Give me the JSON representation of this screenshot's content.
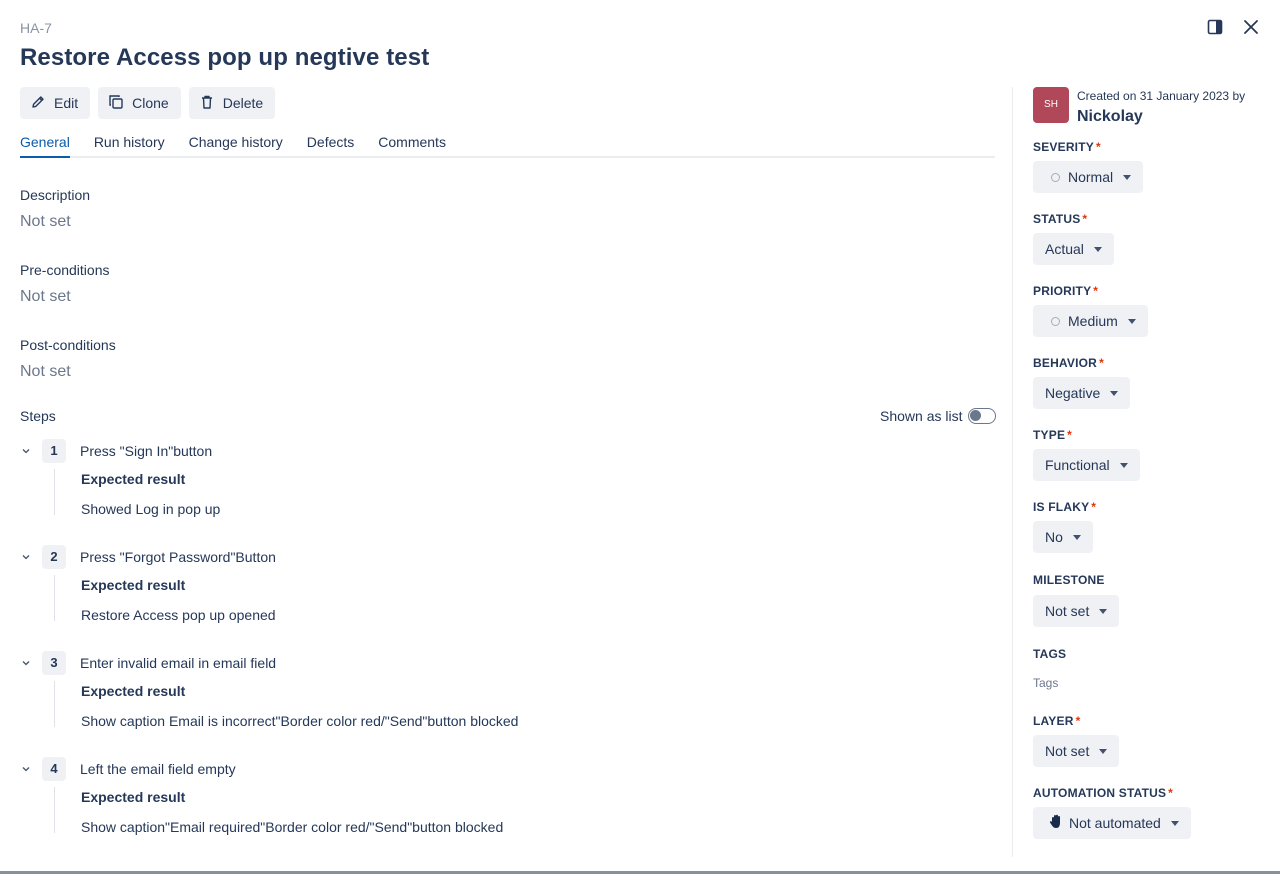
{
  "issue": {
    "key": "HA-7",
    "title": "Restore Access pop up negtive test"
  },
  "window_icons": [
    "panel-toggle-icon",
    "close-icon"
  ],
  "toolbar": {
    "edit_label": "Edit",
    "clone_label": "Clone",
    "delete_label": "Delete"
  },
  "tabs": [
    {
      "label": "General",
      "active": true
    },
    {
      "label": "Run history",
      "active": false
    },
    {
      "label": "Change history",
      "active": false
    },
    {
      "label": "Defects",
      "active": false
    },
    {
      "label": "Comments",
      "active": false
    }
  ],
  "general": {
    "description": {
      "label": "Description",
      "value": "Not set"
    },
    "preconditions": {
      "label": "Pre-conditions",
      "value": "Not set"
    },
    "postconditions": {
      "label": "Post-conditions",
      "value": "Not set"
    }
  },
  "steps": {
    "label": "Steps",
    "toggle_label": "Shown as list",
    "toggle_on": false,
    "expected_label": "Expected result",
    "items": [
      {
        "number": "1",
        "action": "Press \"Sign In\"button",
        "expected": "Showed Log in pop up"
      },
      {
        "number": "2",
        "action": "Press \"Forgot Password\"Button",
        "expected": "Restore Access pop up opened"
      },
      {
        "number": "3",
        "action": "Enter invalid email in email field",
        "expected": "Show caption Email is incorrect\"Border color red/\"Send\"button blocked"
      },
      {
        "number": "4",
        "action": "Left the email field empty",
        "expected": "Show caption\"Email required\"Border color red/\"Send\"button blocked"
      }
    ]
  },
  "sidebar": {
    "avatar_initials": "SH",
    "avatar_color": "#b0485a",
    "created_text": "Created on 31 January 2023 by",
    "author": "Nickolay",
    "required_marker": "*",
    "fields": {
      "severity": {
        "label": "SEVERITY",
        "value": "Normal"
      },
      "status": {
        "label": "STATUS",
        "value": "Actual"
      },
      "priority": {
        "label": "PRIORITY",
        "value": "Medium"
      },
      "behavior": {
        "label": "BEHAVIOR",
        "value": "Negative"
      },
      "type": {
        "label": "TYPE",
        "value": "Functional"
      },
      "is_flaky": {
        "label": "IS FLAKY",
        "value": "No"
      },
      "milestone": {
        "label": "MILESTONE",
        "value": "Not set"
      },
      "tags": {
        "label": "TAGS",
        "placeholder": "Tags"
      },
      "layer": {
        "label": "LAYER",
        "value": "Not set"
      },
      "automation_status": {
        "label": "AUTOMATION STATUS",
        "value": "Not automated",
        "icon": "hand-icon"
      }
    }
  },
  "colors": {
    "accent": "#0b5cad",
    "required": "#de350b",
    "button_bg": "#f0f1f4"
  }
}
